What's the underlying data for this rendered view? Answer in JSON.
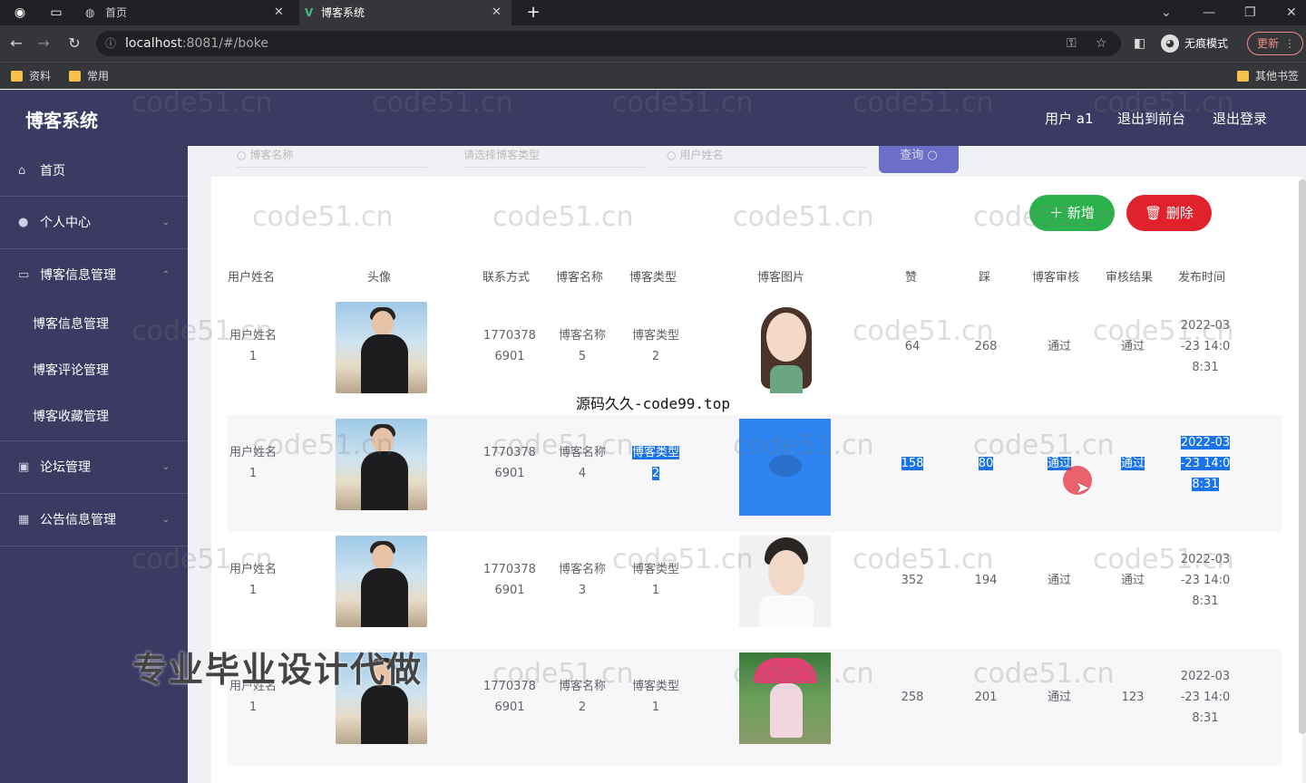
{
  "browser": {
    "tabs": [
      {
        "label": "首页"
      },
      {
        "label": "博客系统"
      }
    ],
    "url_host": "localhost",
    "url_rest": ":8081/#/boke",
    "incognito_label": "无痕模式",
    "update_label": "更新",
    "bookmarks": [
      "资料",
      "常用"
    ],
    "other_bookmarks": "其他书签"
  },
  "header": {
    "title": "博客系统",
    "user": "用户 a1",
    "to_front": "退出到前台",
    "logout": "退出登录"
  },
  "sidebar": {
    "items": [
      {
        "label": "首页"
      },
      {
        "label": "个人中心"
      },
      {
        "label": "博客信息管理"
      },
      {
        "label": "论坛管理"
      },
      {
        "label": "公告信息管理"
      }
    ],
    "submenu": [
      "博客信息管理",
      "博客评论管理",
      "博客收藏管理"
    ]
  },
  "search": {
    "blog_name_placeholder": "博客名称",
    "blog_type_placeholder": "请选择博客类型",
    "user_name_placeholder": "用户姓名",
    "query_label": "查询"
  },
  "actions": {
    "add_label": "新增",
    "delete_label": "删除"
  },
  "table": {
    "columns": [
      "用户姓名",
      "头像",
      "联系方式",
      "博客名称",
      "博客类型",
      "博客图片",
      "赞",
      "踩",
      "博客审核",
      "审核结果",
      "发布时间"
    ],
    "rows": [
      {
        "user": [
          "用户姓名",
          "1"
        ],
        "phone": [
          "1770378",
          "6901"
        ],
        "name": [
          "博客名称",
          "5"
        ],
        "type": [
          "博客类型",
          "2"
        ],
        "up": "64",
        "down": "268",
        "audit": "通过",
        "result": "通过",
        "time": [
          "2022-03",
          "-23 14:0",
          "8:31"
        ]
      },
      {
        "user": [
          "用户姓名",
          "1"
        ],
        "phone": [
          "1770378",
          "6901"
        ],
        "name": [
          "博客名称",
          "4"
        ],
        "type": [
          "博客类型",
          "2"
        ],
        "up": "158",
        "down": "80",
        "audit": "通过",
        "result": "通过",
        "time": [
          "2022-03",
          "-23 14:0",
          "8:31"
        ]
      },
      {
        "user": [
          "用户姓名",
          "1"
        ],
        "phone": [
          "1770378",
          "6901"
        ],
        "name": [
          "博客名称",
          "3"
        ],
        "type": [
          "博客类型",
          "1"
        ],
        "up": "352",
        "down": "194",
        "audit": "通过",
        "result": "通过",
        "time": [
          "2022-03",
          "-23 14:0",
          "8:31"
        ]
      },
      {
        "user": [
          "用户姓名",
          "1"
        ],
        "phone": [
          "1770378",
          "6901"
        ],
        "name": [
          "博客名称",
          "2"
        ],
        "type": [
          "博客类型",
          "1"
        ],
        "up": "258",
        "down": "201",
        "audit": "通过",
        "result": "123",
        "time": [
          "2022-03",
          "-23 14:0",
          "8:31"
        ]
      }
    ]
  },
  "overlays": {
    "watermark": "code51.cn",
    "code99": "源码久久-code99.top",
    "ad": "专业毕业设计代做"
  }
}
